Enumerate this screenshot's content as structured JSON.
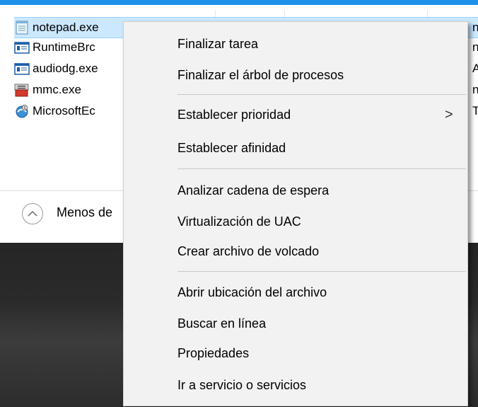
{
  "process_list": {
    "rows": [
      {
        "name": "notepad.exe",
        "right": "n",
        "selected": true
      },
      {
        "name": "RuntimeBrc",
        "right": "n",
        "selected": false
      },
      {
        "name": "audiodg.exe",
        "right": "A",
        "selected": false
      },
      {
        "name": "mmc.exe",
        "right": "n",
        "selected": false
      },
      {
        "name": "MicrosoftEc",
        "right": "TE",
        "selected": false
      }
    ],
    "fewer_details_label": "Menos de"
  },
  "context_menu": {
    "items": [
      "Finalizar tarea",
      "Finalizar el árbol de procesos",
      "Establecer prioridad",
      "Establecer afinidad",
      "Analizar cadena de espera",
      "Virtualización de UAC",
      "Crear archivo de volcado",
      "Abrir ubicación del archivo",
      "Buscar en línea",
      "Propiedades",
      "Ir a servicio o servicios"
    ],
    "submenu_arrow": ">"
  },
  "colors": {
    "accent": "#1e90e8",
    "selection": "#cce8ff",
    "menu_bg": "#f2f2f2"
  }
}
